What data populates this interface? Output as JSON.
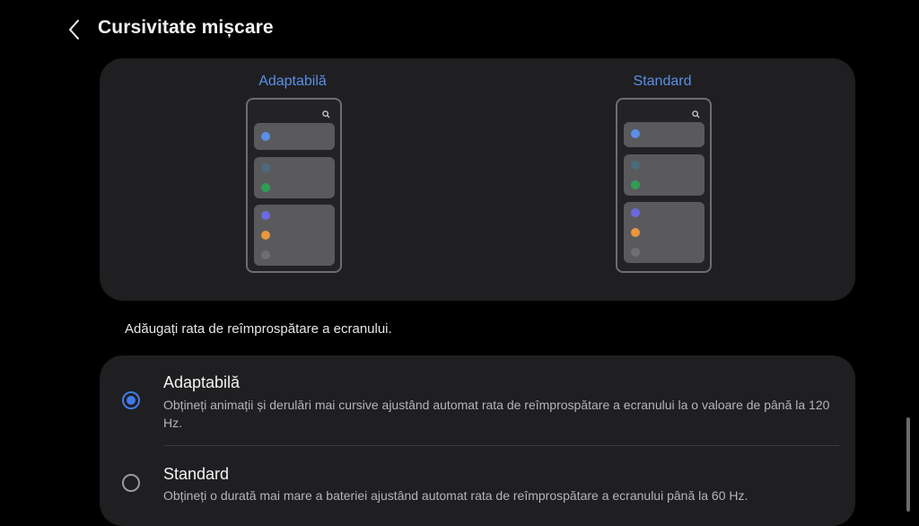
{
  "header": {
    "title": "Cursivitate mișcare",
    "back_icon": "chevron-left-icon"
  },
  "preview": {
    "adaptive": {
      "label": "Adaptabilă",
      "search_icon": "search-icon"
    },
    "standard": {
      "label": "Standard",
      "search_icon": "search-icon"
    },
    "dot_colors": [
      "#5b8fe6",
      "#4b6b7c",
      "#2f9e55",
      "#6a6ae0",
      "#e8973e",
      "#6f6f72"
    ],
    "label_color": "#5b8fe6"
  },
  "hint": "Adăugați rata de reîmprospătare a ecranului.",
  "options": [
    {
      "title": "Adaptabilă",
      "description": "Obțineți animații și derulări mai cursive ajustând automat rata de reîmprospătare a ecranului la o valoare de până la 120 Hz.",
      "selected": true
    },
    {
      "title": "Standard",
      "description": "Obțineți o durată mai mare a bateriei ajustând automat rata de reîmprospătare a ecranului până la 60 Hz.",
      "selected": false
    }
  ],
  "colors": {
    "accent": "#3f7be8",
    "card_bg": "#1f1f21",
    "page_bg": "#000000"
  }
}
